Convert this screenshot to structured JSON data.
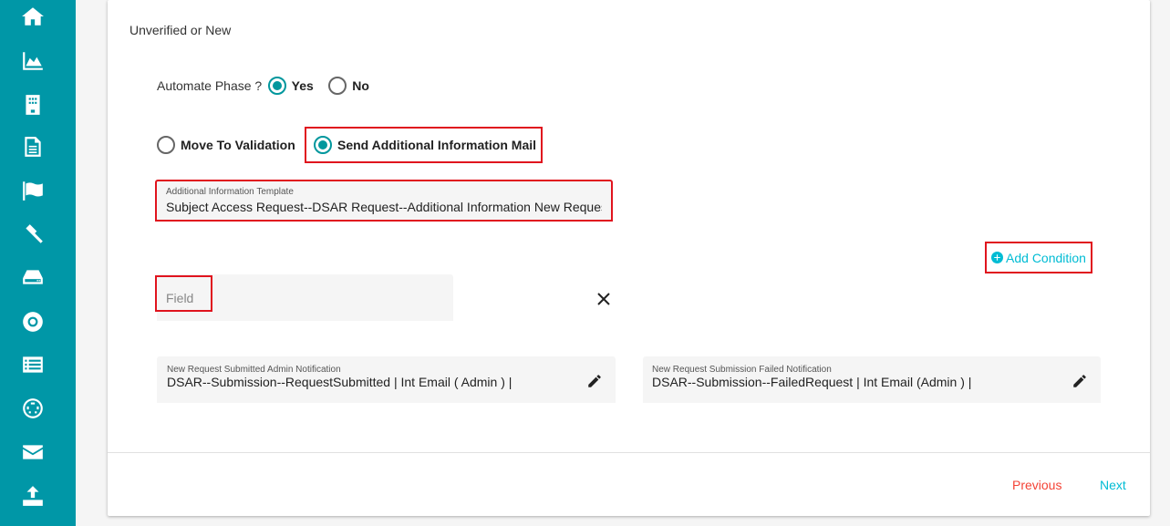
{
  "sidebar": {
    "icons": [
      "home-icon",
      "area-chart-icon",
      "building-icon",
      "document-icon",
      "flag-icon",
      "gavel-icon",
      "hard-drive-icon",
      "life-ring-icon",
      "list-icon",
      "film-reel-icon",
      "envelope-icon",
      "upload-icon"
    ]
  },
  "section_title": "Unverified or New",
  "automate": {
    "label": "Automate Phase ?",
    "yes": "Yes",
    "no": "No",
    "selected": "Yes"
  },
  "action": {
    "option1": "Move To Validation",
    "option2": "Send Additional Information Mail",
    "selected": "Send Additional Information Mail"
  },
  "template": {
    "label": "Additional Information Template",
    "value": "Subject Access Request--DSAR Request--Additional Information New Request"
  },
  "add_condition": "Add Condition",
  "condition": {
    "placeholder": "Field"
  },
  "notifications": [
    {
      "label": "New Request Submitted Admin Notification",
      "value": "DSAR--Submission--RequestSubmitted | Int Email ( Admin ) | "
    },
    {
      "label": "New Request Submission Failed Notification",
      "value": "DSAR--Submission--FailedRequest | Int Email (Admin ) | "
    }
  ],
  "footer": {
    "previous": "Previous",
    "next": "Next"
  },
  "colors": {
    "sidebar": "#0097a7",
    "accent": "#00979d",
    "link": "#00bcd4",
    "previous": "#f44336",
    "highlight": "#e0141e"
  }
}
